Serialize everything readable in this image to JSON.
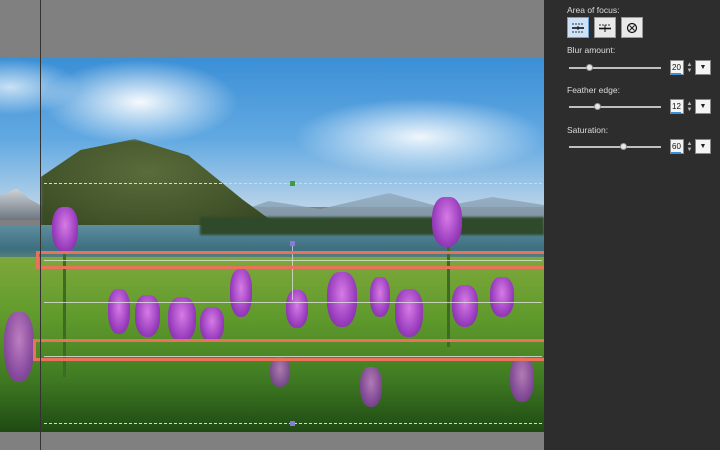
{
  "panel": {
    "area_of_focus_label": "Area of focus:",
    "focus_modes": [
      {
        "icon": "focus-band-icon",
        "active": true
      },
      {
        "icon": "focus-line-icon",
        "active": false
      },
      {
        "icon": "focus-circle-icon",
        "active": false
      }
    ],
    "blur": {
      "label": "Blur amount:",
      "value": "20",
      "slider_fraction": 0.22
    },
    "feather": {
      "label": "Feather edge:",
      "value": "12",
      "slider_fraction": 0.31
    },
    "saturation": {
      "label": "Saturation:",
      "value": "60",
      "slider_fraction": 0.59
    }
  },
  "colors": {
    "highlight": "#e8735a",
    "accent": "#3a8fd9",
    "panel_bg": "#2d2d2d"
  }
}
